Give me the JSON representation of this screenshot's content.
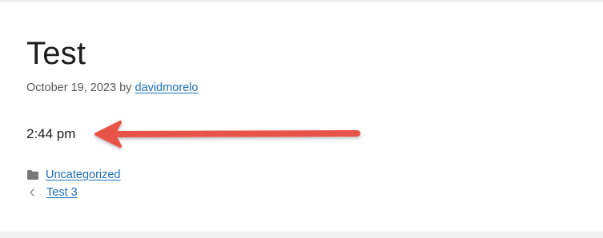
{
  "post": {
    "title": "Test",
    "date": "October 19, 2023",
    "by_label": "by",
    "author": "davidmorelo",
    "content": "2:44 pm"
  },
  "footer": {
    "category": "Uncategorized",
    "previous_post": "Test 3"
  },
  "icons": {
    "category": "folder-icon",
    "previous": "chevron-left-icon",
    "annotation": "arrow-left-icon"
  },
  "colors": {
    "link": "#1e6fb8",
    "arrow": "#e8534a"
  }
}
